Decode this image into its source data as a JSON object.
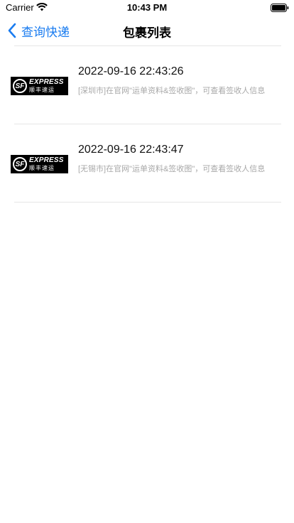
{
  "status_bar": {
    "carrier": "Carrier",
    "time": "10:43 PM"
  },
  "nav": {
    "back_label": "查询快递",
    "title": "包裹列表",
    "accent_color": "#1a7cf0"
  },
  "parcels": [
    {
      "logo": {
        "mark": "SF",
        "name_en": "EXPRESS",
        "name_cn": "顺丰速运"
      },
      "time": "2022-09-16 22:43:26",
      "description": "[深圳市]在官网\"运单资料&签收图\"，可查看签收人信息"
    },
    {
      "logo": {
        "mark": "SF",
        "name_en": "EXPRESS",
        "name_cn": "顺丰速运"
      },
      "time": "2022-09-16 22:43:47",
      "description": "[无锡市]在官网\"运单资料&签收图\"，可查看签收人信息"
    }
  ]
}
